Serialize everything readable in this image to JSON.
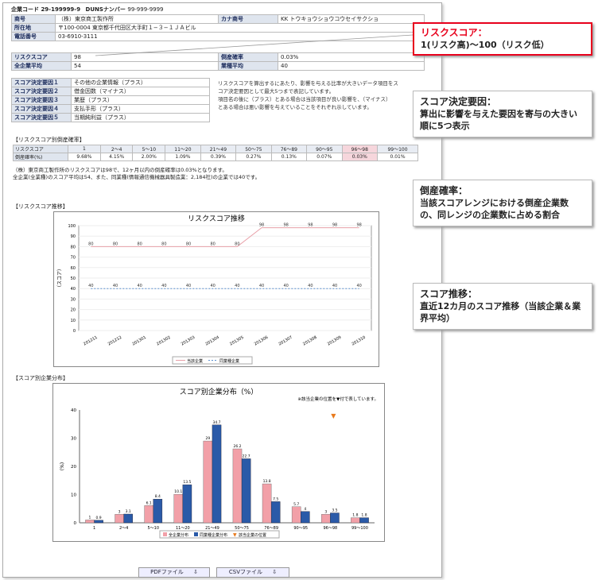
{
  "header": {
    "code_label": "企業コード",
    "code": "29-199999-9",
    "duns_label": "DUNSナンバー",
    "duns": "99-999-9999"
  },
  "company": {
    "name_label": "商号",
    "name": "（株）東京商工製作所",
    "kana_label": "カナ商号",
    "kana": "KK トウキョウショウコウセイサクショ",
    "address_label": "所在地",
    "address": "〒100-0004 東京都千代田区大手町１−３−１ＪＡビル",
    "phone_label": "電話番号",
    "phone": "03-6910-3111"
  },
  "score": {
    "risk_label": "リスクスコア",
    "risk": "98",
    "avg_label": "全企業平均",
    "avg": "54",
    "bankrupt_label": "倒産確率",
    "bankrupt": "0.03%",
    "industry_label": "業種平均",
    "industry": "40"
  },
  "factors": {
    "rows": [
      {
        "label": "スコア決定要因１",
        "value": "その他の企業情報（プラス）"
      },
      {
        "label": "スコア決定要因２",
        "value": "借金因数（マイナス）"
      },
      {
        "label": "スコア決定要因３",
        "value": "業歴（プラス）"
      },
      {
        "label": "スコア決定要因４",
        "value": "支払手形（プラス）"
      },
      {
        "label": "スコア決定要因５",
        "value": "当期純利益（プラス）"
      }
    ],
    "note1": "リスクスコアを算出するにあたり、影響を与える比率が大きいデータ項目をス",
    "note2": "コア決定要因として最大5つまで表記しています。",
    "note3": "項目名の後に（プラス）とある場合は当該項目が良い影響を、（マイナス）",
    "note4": "とある場合は悪い影響を与えていることをそれぞれ示しています。"
  },
  "rate_table": {
    "title": "【リスクスコア別倒産確率】",
    "row1_label": "リスクスコア",
    "row2_label": "倒産確率(%)",
    "ranges": [
      "1",
      "2〜4",
      "5〜10",
      "11〜20",
      "21〜49",
      "50〜75",
      "76〜89",
      "90〜95",
      "96〜98",
      "99〜100"
    ],
    "rates": [
      "9.68%",
      "4.15%",
      "2.00%",
      "1.09%",
      "0.39%",
      "0.27%",
      "0.13%",
      "0.07%",
      "0.03%",
      "0.01%"
    ]
  },
  "summary": {
    "line1": "（株）東京商工製作所のリスクスコアは98で、12ヶ月以内の倒産確率は0.03%となります。",
    "line2": "全企業(全業種)のスコア平均は54、また、同業種(情報通信機械器具製造業：2,184社)の企業では40です。"
  },
  "trend_section": "【リスクスコア推移】",
  "dist_section": "【スコア別企業分布】",
  "chart_data": [
    {
      "type": "line",
      "title": "リスクスコア推移",
      "ylabel": "（スコア）",
      "ylim": [
        0,
        100
      ],
      "yticks": [
        "0",
        "10",
        "20",
        "30",
        "40",
        "50",
        "60",
        "70",
        "80",
        "90",
        "100"
      ],
      "categories": [
        "201211",
        "201212",
        "201301",
        "201302",
        "201303",
        "201304",
        "201305",
        "201306",
        "201307",
        "201308",
        "201309",
        "201310"
      ],
      "series": [
        {
          "name": "当該企業",
          "color": "#e8a0a8",
          "values": [
            80,
            80,
            80,
            80,
            80,
            80,
            80,
            98,
            98,
            98,
            98,
            98
          ]
        },
        {
          "name": "同業種企業",
          "color": "#5b8fd0",
          "values": [
            40,
            40,
            40,
            40,
            40,
            40,
            40,
            40,
            40,
            40,
            40,
            40
          ]
        }
      ],
      "value_labels_company": [
        "80",
        "80",
        "80",
        "80",
        "80",
        "80",
        "80",
        "98",
        "98",
        "98",
        "98",
        "98"
      ],
      "value_labels_industry": [
        "40",
        "40",
        "40",
        "40",
        "40",
        "40",
        "40",
        "40",
        "40",
        "40",
        "40",
        "40"
      ]
    },
    {
      "type": "bar",
      "title": "スコア別企業分布（%）",
      "note": "※該当企業の位置を▼付で表しています。",
      "ylabel": "(%)",
      "ylim": [
        0,
        40
      ],
      "yticks": [
        "0",
        "10",
        "20",
        "30",
        "40"
      ],
      "categories": [
        "1",
        "2〜4",
        "5〜10",
        "11〜20",
        "21〜49",
        "50〜75",
        "76〜89",
        "90〜95",
        "96〜98",
        "99〜100"
      ],
      "series": [
        {
          "name": "全企業分布",
          "color": "#f2a0a8",
          "values": [
            1.0,
            3.0,
            6.1,
            10.1,
            29,
            26.2,
            13.8,
            5.7,
            3.0,
            1.8
          ]
        },
        {
          "name": "同業種企業分布",
          "color": "#2a5aa8",
          "values": [
            0.9,
            3.1,
            8.4,
            13.5,
            34.7,
            22.7,
            7.5,
            4.0,
            3.5,
            1.8
          ]
        }
      ],
      "labels_all": [
        "1",
        "3",
        "6.1",
        "10.1",
        "29",
        "26.2",
        "13.8",
        "5.7",
        "3",
        "1.8"
      ],
      "labels_ind": [
        "0.9",
        "3.1",
        "8.4",
        "13.5",
        "34.7",
        "22.7",
        "7.5",
        "4",
        "3.5",
        "1.8"
      ],
      "marker_label": "該当企業の位置",
      "marker_category": "96〜98"
    }
  ],
  "buttons": {
    "pdf": "PDFファイル",
    "csv": "CSVファイル"
  },
  "callouts": [
    {
      "title": "リスクスコア：",
      "body": "1(リスク高)〜100（リスク低）"
    },
    {
      "title": "スコア決定要因：",
      "body": "算出に影響を与えた要因を寄与の大きい順に5つ表示"
    },
    {
      "title": "倒産確率：",
      "body": "当該スコアレンジにおける倒産企業数の、同レンジの企業数に占める割合"
    },
    {
      "title": "スコア推移：",
      "body": "直近12カ月のスコア推移（当該企業＆業界平均）"
    }
  ],
  "colors": {
    "callout_red": "#e8001c",
    "label_bg": "#dfe5ee",
    "highlight": "#f6d6dc"
  }
}
